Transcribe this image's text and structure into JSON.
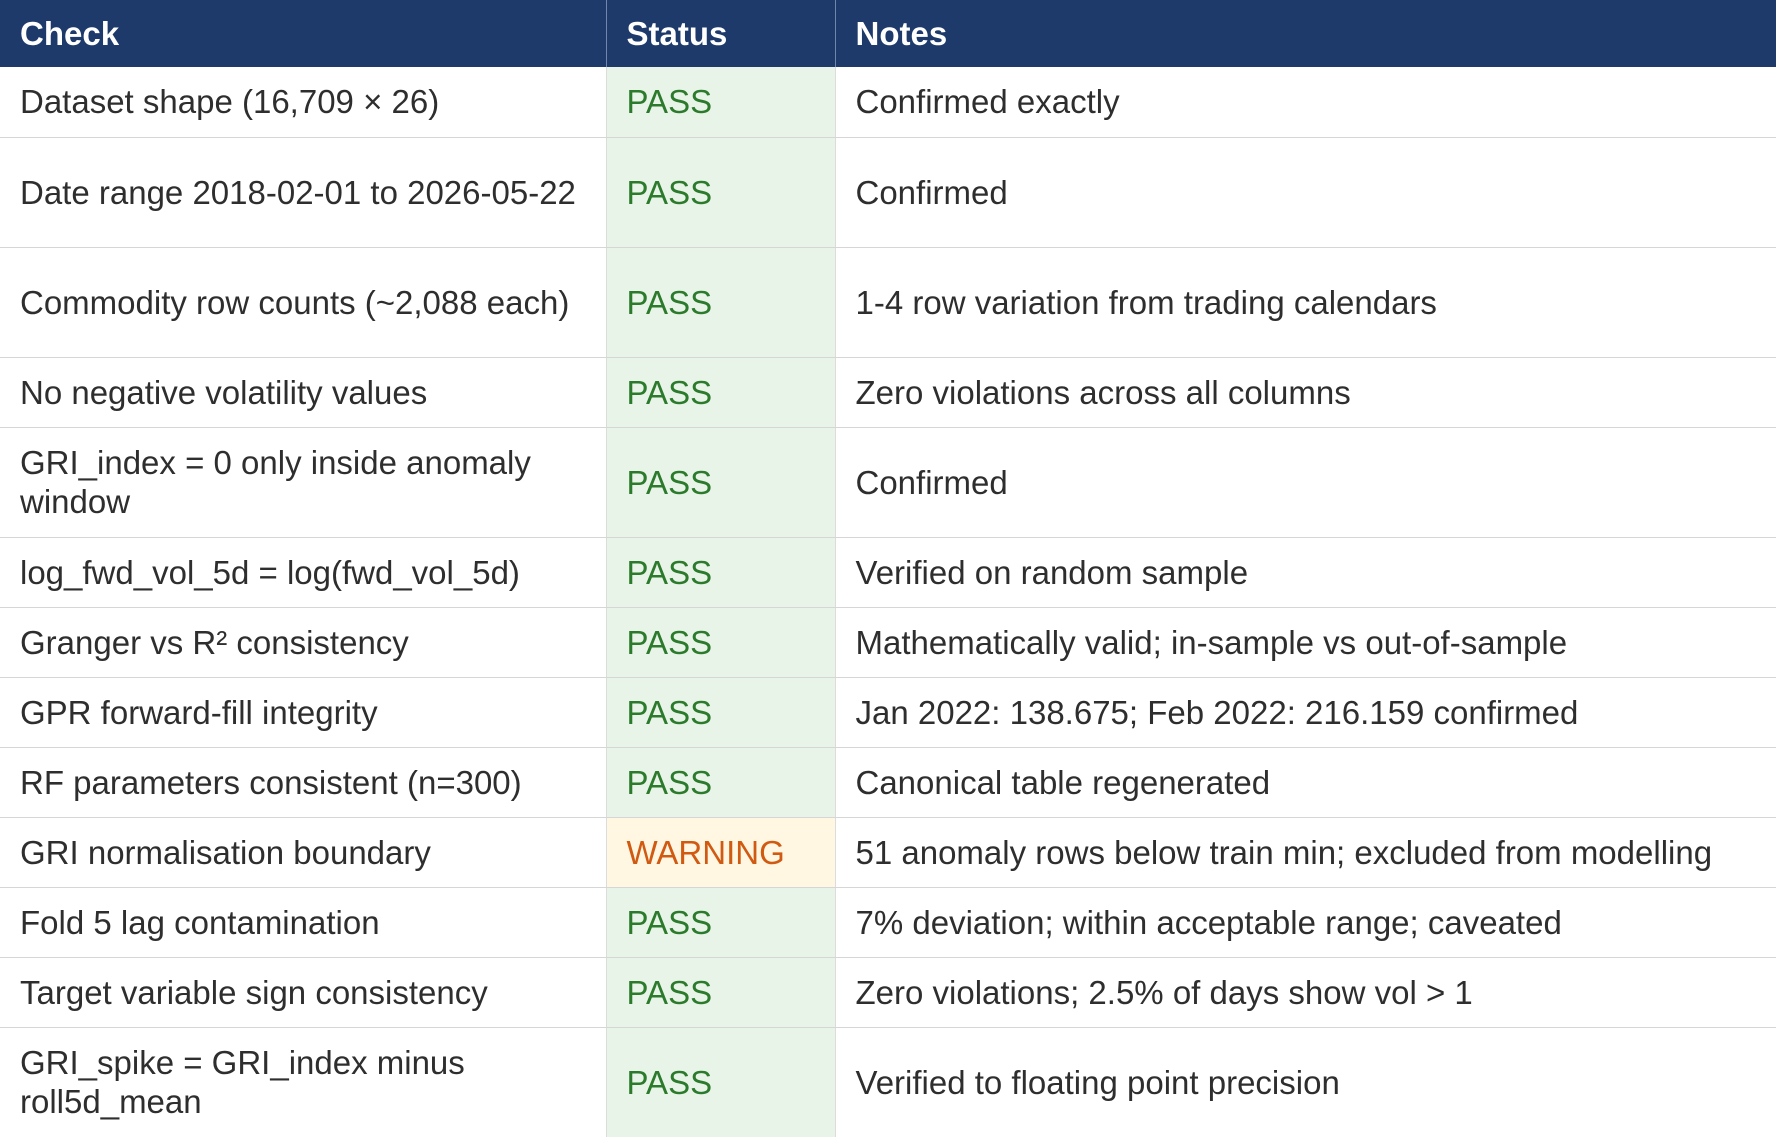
{
  "table": {
    "headers": [
      "Check",
      "Status",
      "Notes"
    ],
    "rows": [
      {
        "check": "Dataset shape (16,709 × 26)",
        "status": "PASS",
        "notes": "Confirmed exactly"
      },
      {
        "check": "Date range 2018-02-01 to 2026-05-22",
        "status": "PASS",
        "notes": "Confirmed"
      },
      {
        "check": "Commodity row counts (~2,088 each)",
        "status": "PASS",
        "notes": "1-4 row variation from trading calendars"
      },
      {
        "check": "No negative volatility values",
        "status": "PASS",
        "notes": "Zero violations across all columns"
      },
      {
        "check": "GRI_index = 0 only inside anomaly window",
        "status": "PASS",
        "notes": "Confirmed"
      },
      {
        "check": "log_fwd_vol_5d = log(fwd_vol_5d)",
        "status": "PASS",
        "notes": "Verified on random sample"
      },
      {
        "check": "Granger vs R² consistency",
        "status": "PASS",
        "notes": "Mathematically valid; in-sample vs out-of-sample"
      },
      {
        "check": "GPR forward-fill integrity",
        "status": "PASS",
        "notes": "Jan 2022: 138.675; Feb 2022: 216.159 confirmed"
      },
      {
        "check": "RF parameters consistent (n=300)",
        "status": "PASS",
        "notes": "Canonical table regenerated"
      },
      {
        "check": "GRI normalisation boundary",
        "status": "WARNING",
        "notes": "51 anomaly rows below train min; excluded from modelling"
      },
      {
        "check": "Fold 5 lag contamination",
        "status": "PASS",
        "notes": "7% deviation; within acceptable range; caveated"
      },
      {
        "check": "Target variable sign consistency",
        "status": "PASS",
        "notes": "Zero violations; 2.5% of days show vol > 1"
      },
      {
        "check": "GRI_spike = GRI_index minus roll5d_mean",
        "status": "PASS",
        "notes": "Verified to floating point precision"
      }
    ]
  },
  "colors": {
    "header_bg": "#1e3a6b",
    "pass_bg": "#e8f4e8",
    "pass_text": "#2c7a2c",
    "warning_bg": "#fff7e2",
    "warning_text": "#d15a12"
  }
}
